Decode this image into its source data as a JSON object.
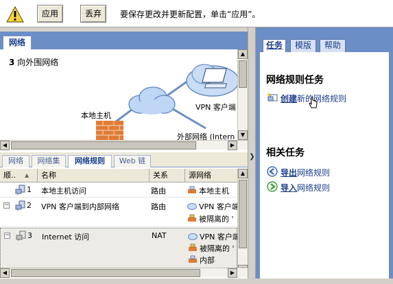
{
  "toolbar": {
    "apply_label": "应用",
    "discard_label": "丢弃",
    "message": "要保存更改并更新配置，单击“应用”。"
  },
  "top_tab": {
    "label": "网络"
  },
  "diagram": {
    "title_number": "3",
    "title_text": "向外围网络",
    "local_host_label": "本地主机",
    "vpn_clients_label": "VPN 客户端",
    "external_label": "外部网络 (Intern"
  },
  "bottom_tabs": [
    {
      "label": "网络"
    },
    {
      "label": "网络集"
    },
    {
      "label": "网络规则"
    },
    {
      "label": "Web 链"
    }
  ],
  "grid": {
    "columns": [
      "顺..",
      "名称",
      "关系",
      "源网络"
    ],
    "rows": [
      {
        "order": "1",
        "name": "本地主机访问",
        "relation": "路由",
        "sources": [
          "本地主机"
        ]
      },
      {
        "order": "2",
        "name": "VPN 客户端到内部网络",
        "relation": "路由",
        "sources": [
          "VPN 客户端",
          "被隔离的 '"
        ]
      },
      {
        "order": "3",
        "name": "Internet 访问",
        "relation": "NAT",
        "sources": [
          "VPN 客户端",
          "被隔离的 '",
          "内部"
        ]
      }
    ]
  },
  "right_tabs": [
    {
      "label": "任务"
    },
    {
      "label": "模版"
    },
    {
      "label": "帮助"
    }
  ],
  "network_tasks": {
    "heading": "网络规则任务",
    "create_bold": "创建",
    "create_rest": "新的网络规则"
  },
  "related_tasks": {
    "heading": "相关任务",
    "export_bold": "导出",
    "export_rest": "网络规则",
    "import_bold": "导入",
    "import_rest": "网络规则"
  }
}
